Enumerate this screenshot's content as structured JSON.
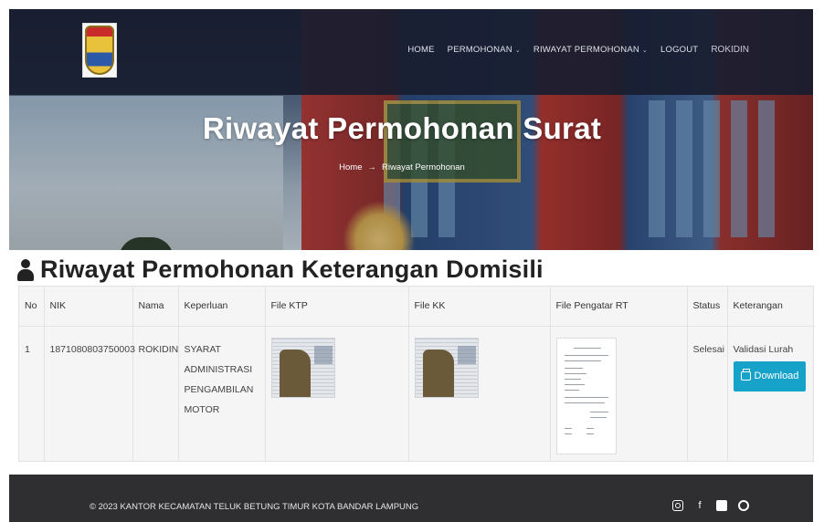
{
  "nav": {
    "items": [
      {
        "label": "HOME",
        "dropdown": false
      },
      {
        "label": "PERMOHONAN",
        "dropdown": true
      },
      {
        "label": "RIWAYAT PERMOHONAN",
        "dropdown": true
      },
      {
        "label": "LOGOUT",
        "dropdown": false
      }
    ],
    "user": "ROKIDIN"
  },
  "hero": {
    "title": "Riwayat Permohonan Surat",
    "breadcrumb": {
      "home": "Home",
      "separator": "→",
      "current": "Riwayat Permohonan"
    }
  },
  "page": {
    "heading": "Riwayat Permohonan Keterangan Domisili",
    "icon": "user-icon"
  },
  "table": {
    "headers": [
      "No",
      "NIK",
      "Nama",
      "Keperluan",
      "File KTP",
      "File KK",
      "File Pengatar RT",
      "Status",
      "Keterangan"
    ],
    "rows": [
      {
        "no": "1",
        "nik": "1871080803750003",
        "nama": "ROKIDIN",
        "keperluan": "SYARAT ADMINISTRASI PENGAMBILAN MOTOR",
        "status": "Selesai",
        "keterangan": "Validasi Lurah",
        "download_label": "Download"
      }
    ]
  },
  "footer": {
    "copyright": "© 2023 KANTOR KECAMATAN TELUK BETUNG TIMUR KOTA BANDAR LAMPUNG",
    "social": [
      "instagram-icon",
      "facebook-icon",
      "youtube-icon",
      "github-icon"
    ]
  },
  "colors": {
    "nav_bg": "#181d30",
    "download_button": "#17a2c9",
    "footer_bg": "#2f2f31"
  }
}
